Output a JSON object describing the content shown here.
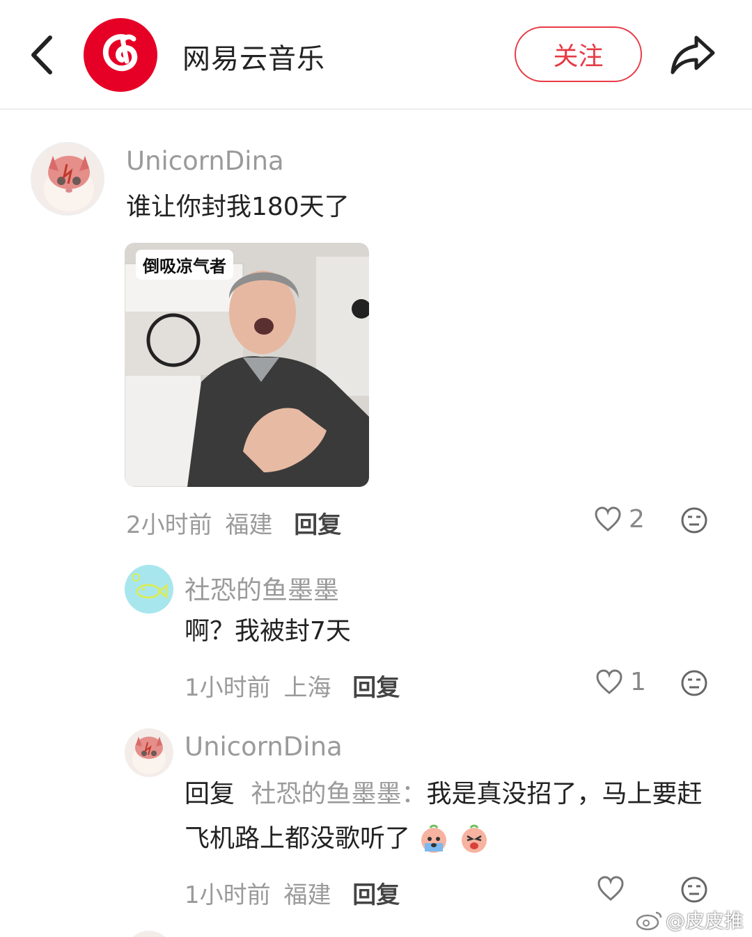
{
  "header": {
    "account_name": "网易云音乐",
    "follow_label": "关注",
    "brand_color": "#e60026"
  },
  "comments": [
    {
      "username": "UnicornDina",
      "text": "谁让你封我180天了",
      "sticker_caption": "倒吸凉气者",
      "time": "2小时前",
      "location": "福建",
      "reply_label": "回复",
      "likes": "2"
    },
    {
      "username": "社恐的鱼墨墨",
      "text": "啊？我被封7天",
      "time": "1小时前",
      "location": "上海",
      "reply_label": "回复",
      "likes": "1"
    },
    {
      "username": "UnicornDina",
      "reply_prefix": "回复",
      "reply_to": "社恐的鱼墨墨",
      "reply_separator": "：",
      "text": "我是真没招了，马上要赶飞机路上都没歌听了",
      "time": "1小时前",
      "location": "福建",
      "reply_label": "回复"
    }
  ],
  "watermark": "@皮皮推",
  "colors": {
    "accent": "#e63b46",
    "muted": "#9a9a9a"
  }
}
